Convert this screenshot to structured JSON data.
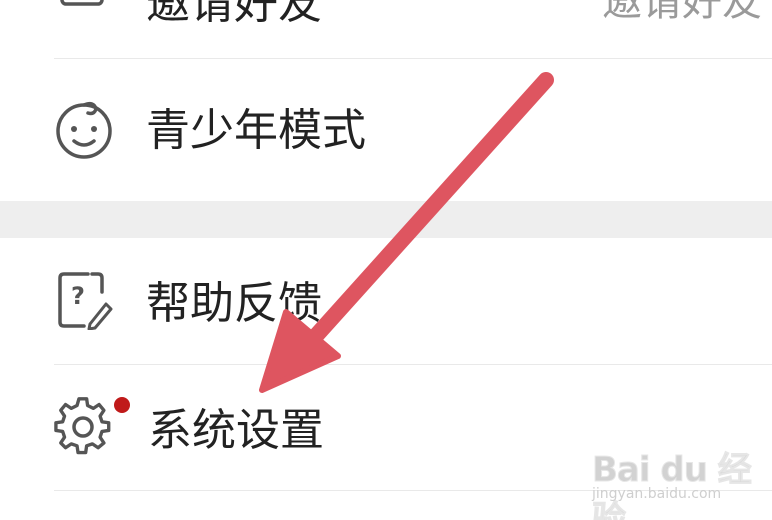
{
  "menu": {
    "invite": {
      "label": "邀请好友",
      "value": "邀请好友",
      "icon": "invite-envelope-icon"
    },
    "teen_mode": {
      "label": "青少年模式",
      "icon": "baby-face-icon"
    },
    "help": {
      "label": "帮助反馈",
      "icon": "help-feedback-icon"
    },
    "settings": {
      "label": "系统设置",
      "icon": "gear-icon",
      "has_notification": true
    }
  },
  "colors": {
    "background": "#ffffff",
    "section_gap": "#eeeeee",
    "divider": "#e9e9e9",
    "label_text": "#222222",
    "value_text": "#9a9a9a",
    "icon_stroke": "#555555",
    "notification_dot": "#c01a1a",
    "annotation_arrow": "#de5560"
  },
  "watermark": {
    "logo": "Bai du 经验",
    "url": "jingyan.baidu.com"
  }
}
